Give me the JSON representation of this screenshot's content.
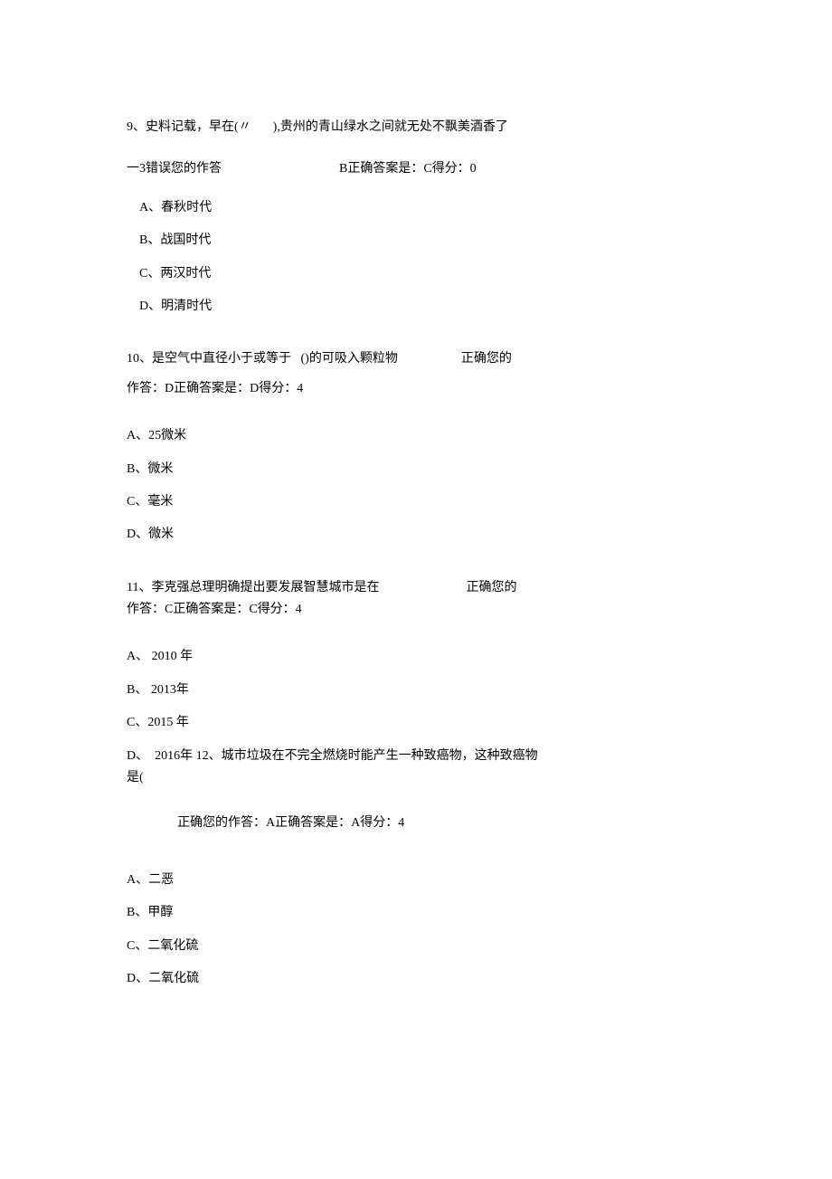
{
  "q9": {
    "line1a": "9、史料记载，早在(〃",
    "line1b": "),贵州的青山绿水之间就无处不飘美酒香了",
    "line2a": "一3错误您的作答",
    "line2b": "B正确答案是：C得分：0",
    "options": [
      "A、春秋时代",
      "B、战国时代",
      "C、两汉时代",
      "D、明清时代"
    ]
  },
  "q10": {
    "line1a": "10、是空气中直径小于或等于   ()的可吸入颗粒物",
    "line1b": "正确您的",
    "line2": "作答：D正确答案是：D得分：4",
    "options": [
      "A、25微米",
      "B、微米",
      "C、毫米",
      "D、微米"
    ]
  },
  "q11": {
    "line1a": "11、李克强总理明确提出要发展智慧城市是在",
    "line1b": "正确您的",
    "line2": "作答：C正确答案是：C得分：4",
    "options": [
      "A、 2010 年",
      "B、 2013年",
      "C、2015 年"
    ]
  },
  "q12": {
    "dline1": "D、  2016年 12、城市垃圾在不完全燃烧时能产生一种致癌物，这种致癌物",
    "dline2": "是(",
    "ans": "正确您的作答：A正确答案是：A得分：4",
    "options": [
      "A、二恶",
      "B、甲醇",
      "C、二氧化硫",
      "D、二氧化硫"
    ]
  }
}
